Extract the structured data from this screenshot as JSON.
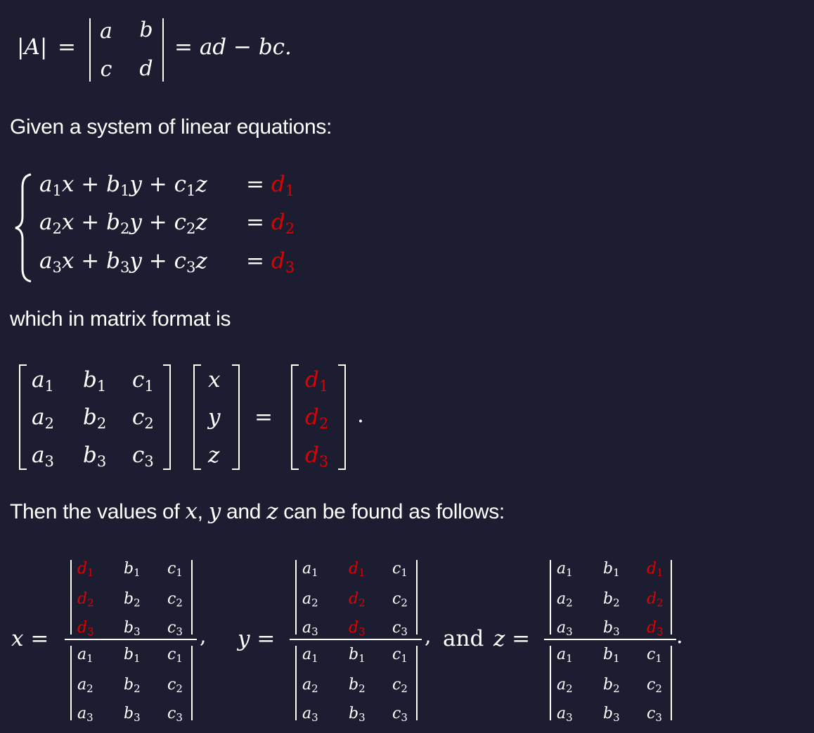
{
  "det2": {
    "lhs": "|A|",
    "eq": "=",
    "matrix": [
      [
        "a",
        "b"
      ],
      [
        "c",
        "d"
      ]
    ],
    "rhs": "= ad − bc."
  },
  "text": {
    "given": "Given a system of linear equations:",
    "matrix_format": "which in matrix format is",
    "then_prefix": "Then the values of ",
    "then_x": "x",
    "then_comma": ",",
    "then_y": "y",
    "then_and": " and ",
    "then_z": "z",
    "then_suffix": " can be found as follows:"
  },
  "system": {
    "rows": [
      {
        "a": "a",
        "i": "1",
        "b": "b",
        "c": "c",
        "d": "d"
      },
      {
        "a": "a",
        "i": "2",
        "b": "b",
        "c": "c",
        "d": "d"
      },
      {
        "a": "a",
        "i": "3",
        "b": "b",
        "c": "c",
        "d": "d"
      }
    ]
  },
  "matrix_eq": {
    "vector": [
      "x",
      "y",
      "z"
    ],
    "equals": "=",
    "period": "."
  },
  "cramer": {
    "x_label": "x =",
    "y_label": "y =",
    "z_and": "and",
    "z_label": "z =",
    "sep": ",",
    "end": "."
  },
  "colors": {
    "background": "#1c1d30",
    "text": "#ffffff",
    "highlight": "#e00000"
  }
}
